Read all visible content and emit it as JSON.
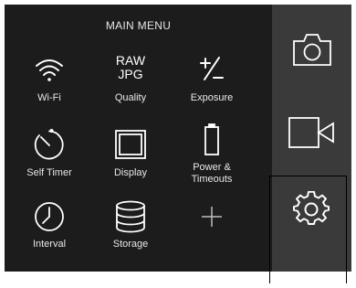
{
  "menu": {
    "title": "MAIN MENU",
    "items": [
      {
        "id": "wifi",
        "label": "Wi-Fi",
        "icon": "wifi-icon"
      },
      {
        "id": "quality",
        "label": "Quality",
        "icon": "raw-jpg-icon",
        "icon_text_top": "RAW",
        "icon_text_bottom": "JPG"
      },
      {
        "id": "exposure",
        "label": "Exposure",
        "icon": "plus-minus-icon"
      },
      {
        "id": "self-timer",
        "label": "Self Timer",
        "icon": "stopwatch-icon"
      },
      {
        "id": "display",
        "label": "Display",
        "icon": "display-icon"
      },
      {
        "id": "power",
        "label": "Power &\nTimeouts",
        "icon": "battery-icon"
      },
      {
        "id": "interval",
        "label": "Interval",
        "icon": "clock-icon"
      },
      {
        "id": "storage",
        "label": "Storage",
        "icon": "database-icon"
      },
      {
        "id": "add",
        "label": "",
        "icon": "plus-icon"
      }
    ]
  },
  "sidebar": {
    "buttons": [
      {
        "id": "photo",
        "icon": "camera-icon"
      },
      {
        "id": "video",
        "icon": "video-camera-icon"
      },
      {
        "id": "settings",
        "icon": "gear-icon"
      }
    ]
  },
  "colors": {
    "menu_bg": "#1c1c1c",
    "sidebar_bg": "#3a3a3a",
    "icon": "#ffffff",
    "text": "#e8e8e8"
  }
}
